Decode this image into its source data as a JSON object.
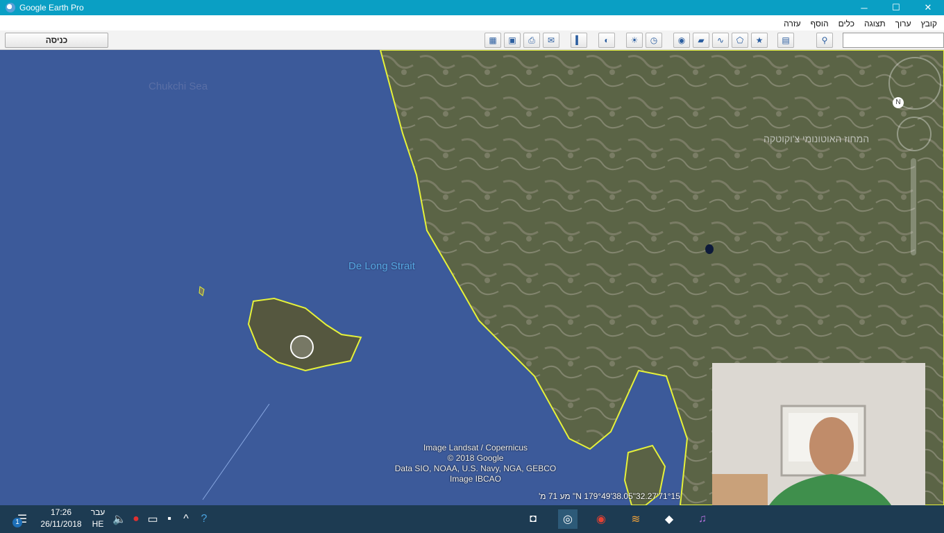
{
  "window": {
    "title": "Google Earth Pro",
    "minimize": "─",
    "maximize": "☐",
    "close": "✕"
  },
  "menu": [
    "קובץ",
    "ערוך",
    "תצוגה",
    "כלים",
    "הוסף",
    "עזרה"
  ],
  "toolbar": {
    "signin_label": "כניסה",
    "buttons": [
      "hide-sidebar-icon",
      "add-placemark-icon",
      "add-polygon-icon",
      "add-path-icon",
      "add-overlay-icon",
      "record-tour-icon",
      "historical-imagery-icon",
      "sunlight-icon",
      "planets-icon",
      "ruler-icon",
      "email-icon",
      "print-icon",
      "save-image-icon",
      "view-in-maps-icon"
    ]
  },
  "search": {
    "icon": "search-icon",
    "value": ""
  },
  "map": {
    "strait_label": "De Long Strait",
    "sea_label": "Chukchi Sea",
    "city_label": "המחוז האוטונומי צ'וקוטקה",
    "attribution": [
      "Image Landsat / Copernicus",
      "© 2018 Google",
      "Data SIO, NOAA, U.S. Navy, NGA, GEBCO",
      "Image IBCAO"
    ],
    "coordinates": "71°15'32.27\"N   179°49'38.05\" מע   71 מ'"
  },
  "taskbar": {
    "time": "17:26",
    "date": "26/11/2018",
    "lang_top": "עבר",
    "lang_bottom": "HE",
    "notification_count": "1"
  },
  "colors": {
    "titlebar": "#0a9fc4",
    "sea": "#3c5a9a",
    "coast": "#e6f23a",
    "taskbar": "#1d3b52"
  }
}
